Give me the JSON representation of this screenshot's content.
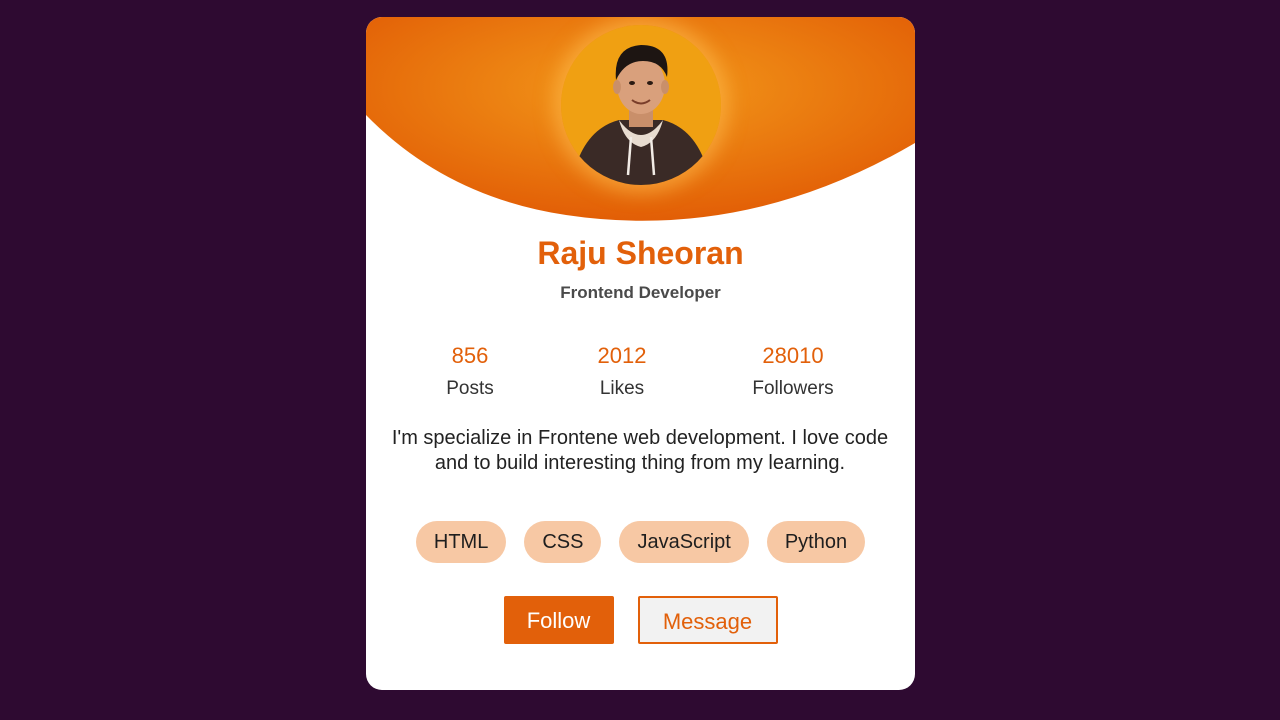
{
  "profile": {
    "name": "Raju Sheoran",
    "role": "Frontend Developer",
    "bio": "I'm specialize in Frontene web development. I love code and to build interesting thing from my learning."
  },
  "stats": [
    {
      "value": "856",
      "label": "Posts"
    },
    {
      "value": "2012",
      "label": "Likes"
    },
    {
      "value": "28010",
      "label": "Followers"
    }
  ],
  "skills": [
    "HTML",
    "CSS",
    "JavaScript",
    "Python"
  ],
  "actions": {
    "follow_label": "Follow",
    "message_label": "Message"
  },
  "colors": {
    "background": "#2e0a31",
    "accent": "#e2600a",
    "skill_chip": "#f7c8a4",
    "card": "#ffffff"
  }
}
